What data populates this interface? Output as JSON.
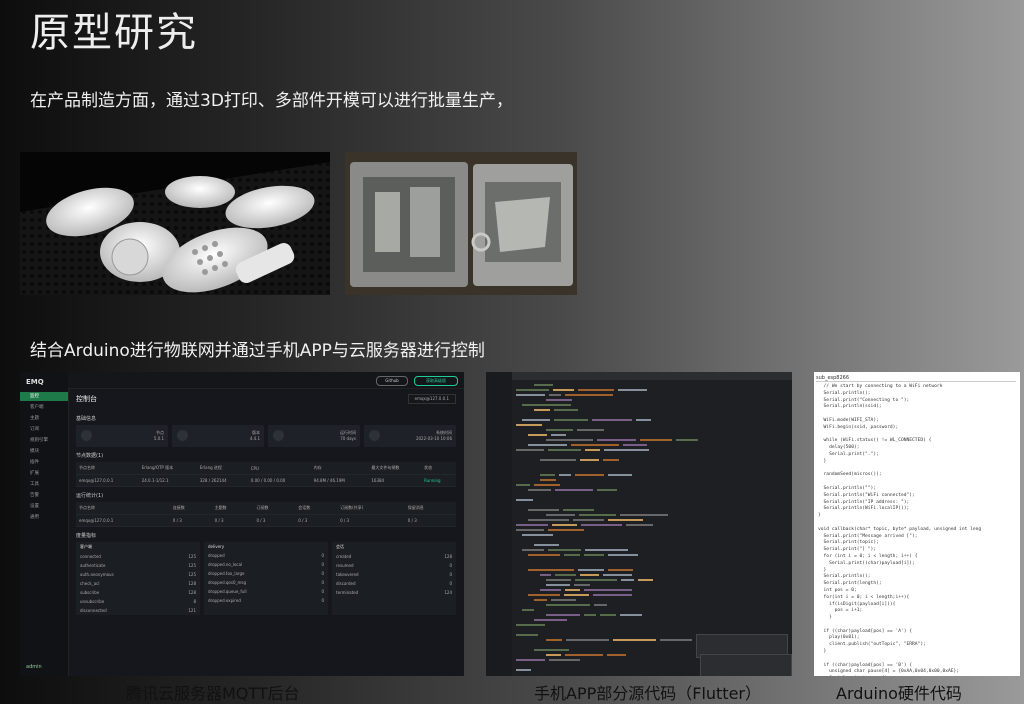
{
  "title": "原型研究",
  "subtitle_manufacturing": "在产品制造方面，通过3D打印、多部件开模可以进行批量生产，",
  "subtitle_iot": "结合Arduino进行物联网并通过手机APP与云服务器进行控制",
  "captions": {
    "mqtt": "腾讯云服务器MQTT后台",
    "flutter": "手机APP部分源代码（Flutter）",
    "arduino": "Arduino硬件代码"
  },
  "emq": {
    "logo": "EMQ",
    "nav": [
      "监控",
      "客户端",
      "主题",
      "订阅",
      "规则引擎",
      "模块",
      "插件",
      "扩展",
      "工具",
      "告警",
      "设置",
      "通用"
    ],
    "page_title": "控制台",
    "node_select": "emqx@127.0.0.1",
    "btn_github": "Github",
    "btn_upgrade": "获取高级版",
    "section_basic": "基础信息",
    "cards": [
      {
        "label": "节点",
        "value": "5.0.1"
      },
      {
        "label": "版本",
        "value": "4.4.1"
      },
      {
        "label": "运行时间",
        "value": "70 days"
      },
      {
        "label": "系统时间",
        "value": "2022-03-10 10:06"
      }
    ],
    "section_nodes": "节点数据(1)",
    "node_headers": [
      "节点名称",
      "Erlang/OTP 版本",
      "Erlang 进程",
      "CPU",
      "内存",
      "最大文件句柄数",
      "状态"
    ],
    "node_row": [
      "emqx@127.0.0.1",
      "24.0.1-1/12.1",
      "328 / 262144",
      "0.00 / 0.00 / 0.00",
      "94.8M / 46.19M",
      "16384",
      "Running"
    ],
    "section_stats": "运行统计(1)",
    "stat_headers": [
      "节点名称",
      "连接数",
      "主题数",
      "订阅数",
      "会话数",
      "订阅数(共享)",
      "保留消息"
    ],
    "stat_row": [
      "emqx@127.0.0.1",
      "0 / 3",
      "0 / 3",
      "0 / 3",
      "0 / 3",
      "0 / 3",
      "0 / 3"
    ],
    "section_metrics": "度量指标",
    "metric_cols": [
      {
        "head": "客户端",
        "rows": [
          [
            "connected",
            "125"
          ],
          [
            "authenticate",
            "125"
          ],
          [
            "auth.anonymous",
            "125"
          ],
          [
            "check_acl",
            "128"
          ],
          [
            "subscribe",
            "128"
          ],
          [
            "unsubscribe",
            "8"
          ],
          [
            "disconnected",
            "121"
          ]
        ]
      },
      {
        "head": "delivery",
        "rows": [
          [
            "dropped",
            "0"
          ],
          [
            "dropped.no_local",
            "0"
          ],
          [
            "dropped.too_large",
            "0"
          ],
          [
            "dropped.qos0_msg",
            "0"
          ],
          [
            "dropped.queue_full",
            "0"
          ],
          [
            "dropped.expired",
            "0"
          ],
          [
            "",
            ""
          ]
        ]
      },
      {
        "head": "会话",
        "rows": [
          [
            "created",
            "128"
          ],
          [
            "resumed",
            "0"
          ],
          [
            "takeovered",
            "0"
          ],
          [
            "discarded",
            "0"
          ],
          [
            "terminated",
            "124"
          ],
          [
            "",
            ""
          ],
          [
            "",
            ""
          ]
        ]
      }
    ],
    "admin": "admin"
  },
  "arduino": {
    "tab": "sub_esp8266",
    "code": "  // We start by connecting to a WiFi network\n  Serial.println();\n  Serial.print(\"Connecting to \");\n  Serial.println(ssid);\n\n  WiFi.mode(WIFI_STA);\n  WiFi.begin(ssid, password);\n\n  while (WiFi.status() != WL_CONNECTED) {\n    delay(500);\n    Serial.print(\".\");\n  }\n\n  randomSeed(micros());\n\n  Serial.println(\"\");\n  Serial.println(\"WiFi connected\");\n  Serial.println(\"IP address: \");\n  Serial.println(WiFi.localIP());\n}\n\nvoid callback(char* topic, byte* payload, unsigned int leng\n  Serial.print(\"Message arrived [\");\n  Serial.print(topic);\n  Serial.print(\"] \");\n  for (int i = 0; i < length; i++) {\n    Serial.print((char)payload[i]);\n  }\n  Serial.println();\n  Serial.print(length);\n  int pos = 0;\n  for(int i = 0; i < length;i++){\n    if(isDigit(payload[i])){\n      pos = i+1;\n    }\n\n  if ((char)payload[pos] == 'A') {\n    play(0x01);\n    client.publish(\"outTopic\", \"ERRA\");\n  }\n\n  if ((char)payload[pos] == 'B') {\n    unsigned char pause[4] = {0xAA,0x04,0x00,0xAE};\n    Serial.write(pause,4);"
  }
}
